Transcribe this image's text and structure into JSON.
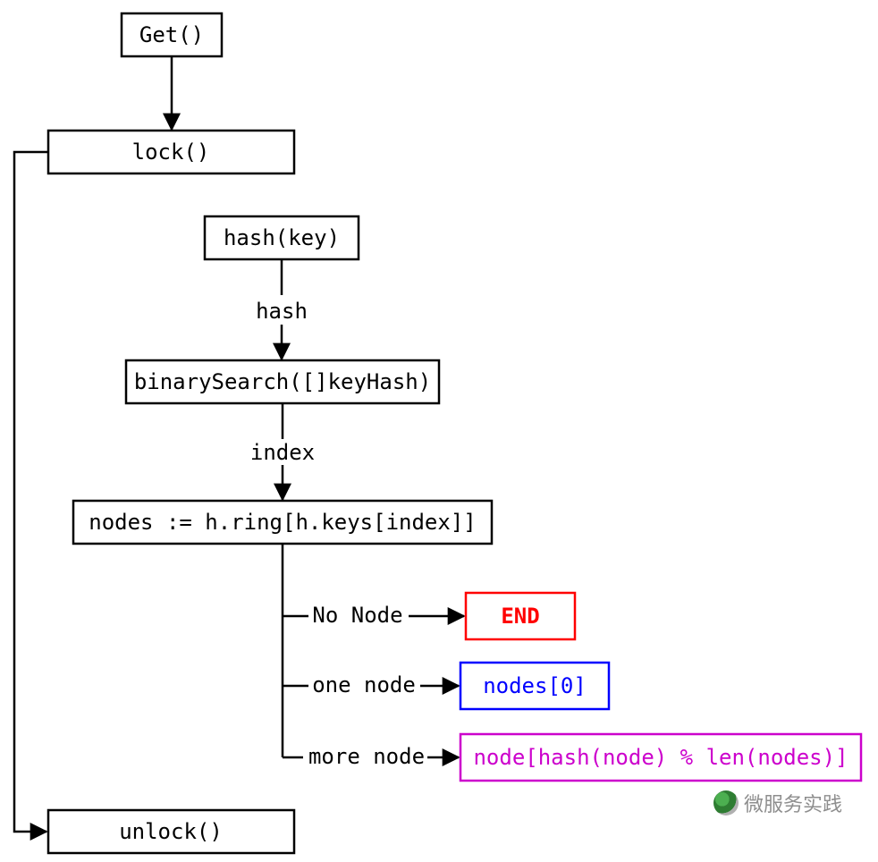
{
  "nodes": {
    "get": {
      "label": "Get()"
    },
    "lock": {
      "label": "lock()"
    },
    "hashkey": {
      "label": "hash(key)"
    },
    "bsearch": {
      "label": "binarySearch([]keyHash)"
    },
    "assign": {
      "label": "nodes := h.ring[h.keys[index]]"
    },
    "end": {
      "label": "END"
    },
    "one": {
      "label": "nodes[0]"
    },
    "more": {
      "label": "node[hash(node) % len(nodes)]"
    },
    "unlock": {
      "label": "unlock()"
    }
  },
  "edges": {
    "hash_to_bsearch": {
      "label": "hash"
    },
    "bsearch_to_assign": {
      "label": "index"
    },
    "branch_no": {
      "label": "No Node"
    },
    "branch_one": {
      "label": "one node"
    },
    "branch_more": {
      "label": "more node"
    }
  },
  "colors": {
    "end": "#ff0000",
    "one": "#0000ff",
    "more": "#cc00cc",
    "border": "#000000"
  },
  "watermark": {
    "text": "微服务实践"
  }
}
